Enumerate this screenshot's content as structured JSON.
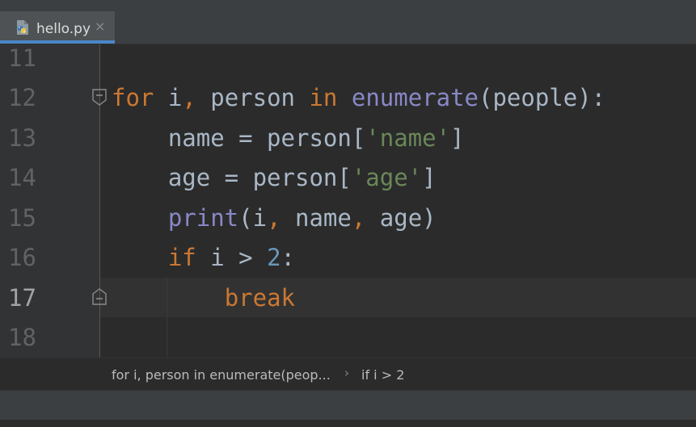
{
  "tab": {
    "label": "hello.py",
    "close_glyph": "×",
    "icon": "python-file-icon"
  },
  "gutter": {
    "line_numbers": [
      "11",
      "12",
      "13",
      "14",
      "15",
      "16",
      "17",
      "18"
    ],
    "current_line": "17"
  },
  "code": {
    "line12": {
      "kw_for": "for",
      "sp1": " i",
      "comma1": ",",
      "sp2": " person ",
      "kw_in": "in",
      "sp3": " ",
      "fn_enumerate": "enumerate",
      "rest": "(people):"
    },
    "line13": {
      "indent": "    ",
      "lhs": "name = person[",
      "str": "'name'",
      "rhs": "]"
    },
    "line14": {
      "indent": "    ",
      "lhs": "age = person[",
      "str": "'age'",
      "rhs": "]"
    },
    "line15": {
      "indent": "    ",
      "fn_print": "print",
      "open": "(i",
      "comma1": ",",
      "mid": " name",
      "comma2": ",",
      "end": " age)"
    },
    "line16": {
      "indent": "    ",
      "kw_if": "if",
      "mid": " i > ",
      "num": "2",
      "end": ":"
    },
    "line17": {
      "indent": "        ",
      "kw_break": "break"
    }
  },
  "breadcrumbs": {
    "items": [
      "for i, person in enumerate(peop...",
      "if i > 2"
    ],
    "separator": "›"
  },
  "colors": {
    "keyword": "#cc7832",
    "builtin": "#8888c6",
    "string": "#6a8759",
    "number": "#6897bb",
    "text": "#a9b7c6",
    "accent_tab_underline": "#4a88c7"
  }
}
